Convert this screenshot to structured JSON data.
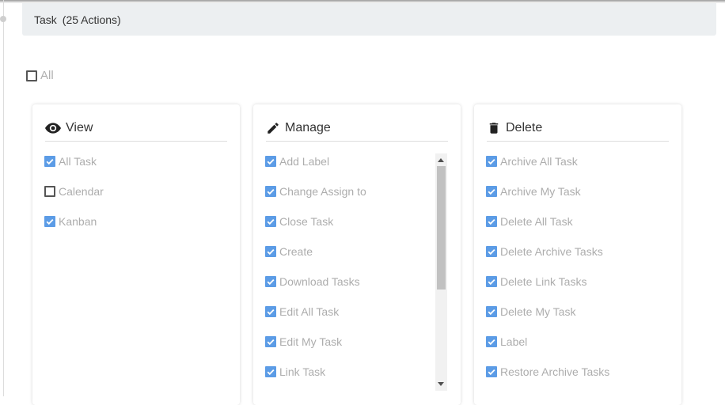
{
  "section": {
    "title": "Task",
    "count": "(25 Actions)"
  },
  "select_all": {
    "label": "All",
    "checked": false
  },
  "colors": {
    "accent": "#5c9ce6",
    "header_bg": "#eceff1",
    "muted_text": "#adadad"
  },
  "cards": [
    {
      "title": "View",
      "icon": "eye-icon",
      "items": [
        {
          "label": "All Task",
          "checked": true
        },
        {
          "label": "Calendar",
          "checked": false
        },
        {
          "label": "Kanban",
          "checked": true
        }
      ]
    },
    {
      "title": "Manage",
      "icon": "pencil-icon",
      "items": [
        {
          "label": "Add Label",
          "checked": true
        },
        {
          "label": "Change Assign to",
          "checked": true
        },
        {
          "label": "Close Task",
          "checked": true
        },
        {
          "label": "Create",
          "checked": true
        },
        {
          "label": "Download Tasks",
          "checked": true
        },
        {
          "label": "Edit All Task",
          "checked": true
        },
        {
          "label": "Edit My Task",
          "checked": true
        },
        {
          "label": "Link Task",
          "checked": true
        }
      ]
    },
    {
      "title": "Delete",
      "icon": "trash-icon",
      "items": [
        {
          "label": "Archive All Task",
          "checked": true
        },
        {
          "label": "Archive My Task",
          "checked": true
        },
        {
          "label": "Delete All Task",
          "checked": true
        },
        {
          "label": "Delete Archive Tasks",
          "checked": true
        },
        {
          "label": "Delete Link Tasks",
          "checked": true
        },
        {
          "label": "Delete My Task",
          "checked": true
        },
        {
          "label": "Label",
          "checked": true
        },
        {
          "label": "Restore Archive Tasks",
          "checked": true
        }
      ]
    }
  ]
}
